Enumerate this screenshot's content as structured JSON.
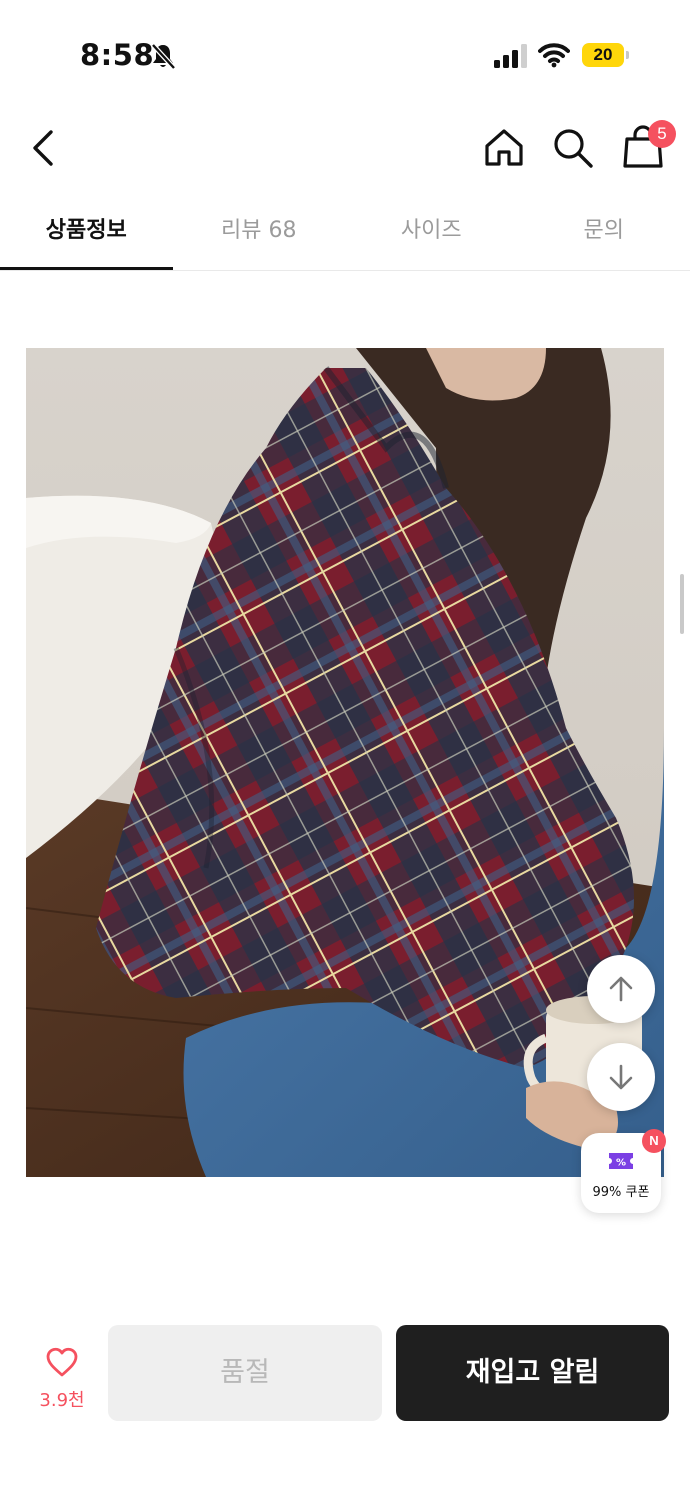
{
  "status_bar": {
    "time": "8:58",
    "battery_level": "20",
    "battery_color": "#ffd60a",
    "icons": [
      "bell-slash-icon",
      "cellular-signal-icon",
      "wifi-icon",
      "battery-icon"
    ]
  },
  "nav": {
    "icons": [
      "back-chevron-icon",
      "home-icon",
      "search-icon",
      "shopping-bag-icon"
    ],
    "cart_count": "5"
  },
  "tabs": [
    {
      "label": "상품정보",
      "active": true
    },
    {
      "label": "리뷰 68",
      "active": false
    },
    {
      "label": "사이즈",
      "active": false
    },
    {
      "label": "문의",
      "active": false
    }
  ],
  "product_image": {
    "subject": "plaid-shirt-photo"
  },
  "floating": {
    "icons": [
      "arrow-up-icon",
      "arrow-down-icon",
      "coupon-ticket-icon"
    ],
    "coupon_label": "99% 쿠폰",
    "coupon_badge": "N"
  },
  "bottom_bar": {
    "like_count": "3.9천",
    "soldout_label": "품절",
    "restock_label": "재입고 알림"
  },
  "colors": {
    "accent_red": "#f5515f",
    "dark_button": "#1f1f1f",
    "disabled_button": "#efefef",
    "coupon_purple": "#7b3fe4"
  }
}
